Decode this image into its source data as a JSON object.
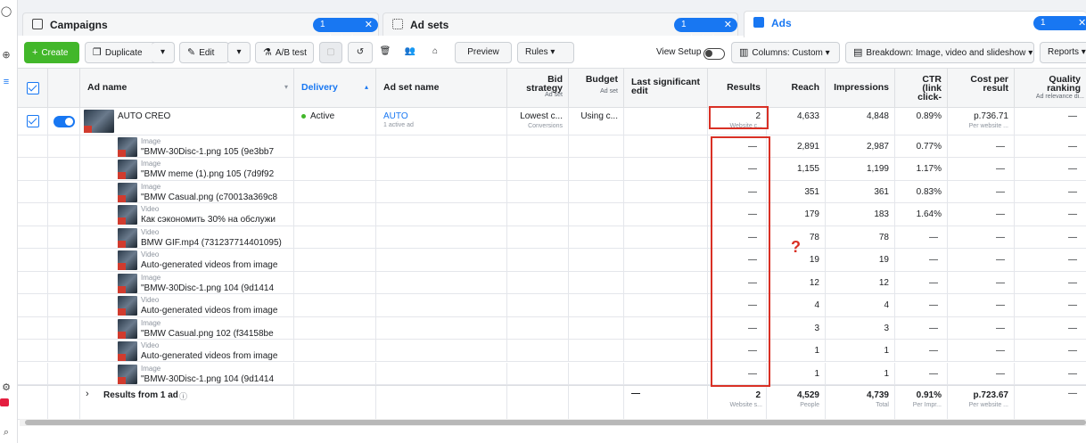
{
  "tabs": {
    "campaigns": {
      "label": "Campaigns",
      "selected": "1 selected"
    },
    "adsets": {
      "label": "Ad sets",
      "selected": "1 selected"
    },
    "ads": {
      "label": "Ads",
      "selected": "1 selected"
    }
  },
  "toolbar": {
    "create": "Create",
    "duplicate": "Duplicate",
    "edit": "Edit",
    "abtest": "A/B test",
    "preview": "Preview",
    "rules": "Rules",
    "view_setup": "View Setup",
    "columns": "Columns: Custom",
    "breakdown": "Breakdown: Image, video and slideshow",
    "reports": "Reports"
  },
  "headers": {
    "ad_name": "Ad name",
    "delivery": "Delivery",
    "ad_set_name": "Ad set name",
    "bid_strategy": "Bid strategy",
    "bid_sub": "Ad set",
    "budget": "Budget",
    "budget_sub": "Ad set",
    "last_edit": "Last significant edit",
    "results": "Results",
    "reach": "Reach",
    "impressions": "Impressions",
    "ctr": "CTR (link click-",
    "cost": "Cost per result",
    "quality": "Quality ranking",
    "quality_sub": "Ad relevance di..."
  },
  "main_row": {
    "name": "AUTO CREO",
    "delivery": "Active",
    "adset": "AUTO",
    "adset_sub": "1 active ad",
    "bid": "Lowest c...",
    "bid_sub": "Conversions",
    "budget": "Using c...",
    "results": "2",
    "results_sub": "Website c...",
    "reach": "4,633",
    "impressions": "4,848",
    "ctr": "0.89%",
    "cost": "р.736.71",
    "cost_sub": "Per website ...",
    "quality": "—"
  },
  "breakdown_rows": [
    {
      "type": "Image",
      "name": "\"BMW-30Disc-1.png 105 (9e3bb7",
      "results": "—",
      "reach": "2,891",
      "impressions": "2,987",
      "ctr": "0.77%",
      "cost": "—",
      "quality": "—"
    },
    {
      "type": "Image",
      "name": "\"BMW meme (1).png 105 (7d9f92",
      "results": "—",
      "reach": "1,155",
      "impressions": "1,199",
      "ctr": "1.17%",
      "cost": "—",
      "quality": "—"
    },
    {
      "type": "Image",
      "name": "\"BMW Casual.png (c70013a369c8",
      "results": "—",
      "reach": "351",
      "impressions": "361",
      "ctr": "0.83%",
      "cost": "—",
      "quality": "—"
    },
    {
      "type": "Video",
      "name": "Как сэкономить 30% на обслужи",
      "results": "—",
      "reach": "179",
      "impressions": "183",
      "ctr": "1.64%",
      "cost": "—",
      "quality": "—"
    },
    {
      "type": "Video",
      "name": "BMW GIF.mp4 (731237714401095)",
      "results": "—",
      "reach": "78",
      "impressions": "78",
      "ctr": "—",
      "cost": "—",
      "quality": "—"
    },
    {
      "type": "Video",
      "name": "Auto-generated videos from image",
      "results": "—",
      "reach": "19",
      "impressions": "19",
      "ctr": "—",
      "cost": "—",
      "quality": "—"
    },
    {
      "type": "Image",
      "name": "\"BMW-30Disc-1.png 104 (9d1414",
      "results": "—",
      "reach": "12",
      "impressions": "12",
      "ctr": "—",
      "cost": "—",
      "quality": "—"
    },
    {
      "type": "Video",
      "name": "Auto-generated videos from image",
      "results": "—",
      "reach": "4",
      "impressions": "4",
      "ctr": "—",
      "cost": "—",
      "quality": "—"
    },
    {
      "type": "Image",
      "name": "\"BMW Casual.png 102 (f34158be",
      "results": "—",
      "reach": "3",
      "impressions": "3",
      "ctr": "—",
      "cost": "—",
      "quality": "—"
    },
    {
      "type": "Video",
      "name": "Auto-generated videos from image",
      "results": "—",
      "reach": "1",
      "impressions": "1",
      "ctr": "—",
      "cost": "—",
      "quality": "—"
    },
    {
      "type": "Image",
      "name": "\"BMW-30Disc-1.png 104 (9d1414",
      "results": "—",
      "reach": "1",
      "impressions": "1",
      "ctr": "—",
      "cost": "—",
      "quality": "—"
    }
  ],
  "totals": {
    "label": "Results from 1 ad",
    "last_edit": "—",
    "results": "2",
    "results_sub": "Website s...",
    "reach": "4,529",
    "reach_sub": "People",
    "impressions": "4,739",
    "impressions_sub": "Total",
    "ctr": "0.91%",
    "ctr_sub": "Per Impr...",
    "cost": "р.723.67",
    "cost_sub": "Per website ...",
    "quality": "—"
  },
  "annotation": {
    "mark": "?"
  },
  "colors": {
    "accent": "#1877f2",
    "create": "#42b72a",
    "highlight": "#d93025",
    "active": "#42b72a"
  }
}
